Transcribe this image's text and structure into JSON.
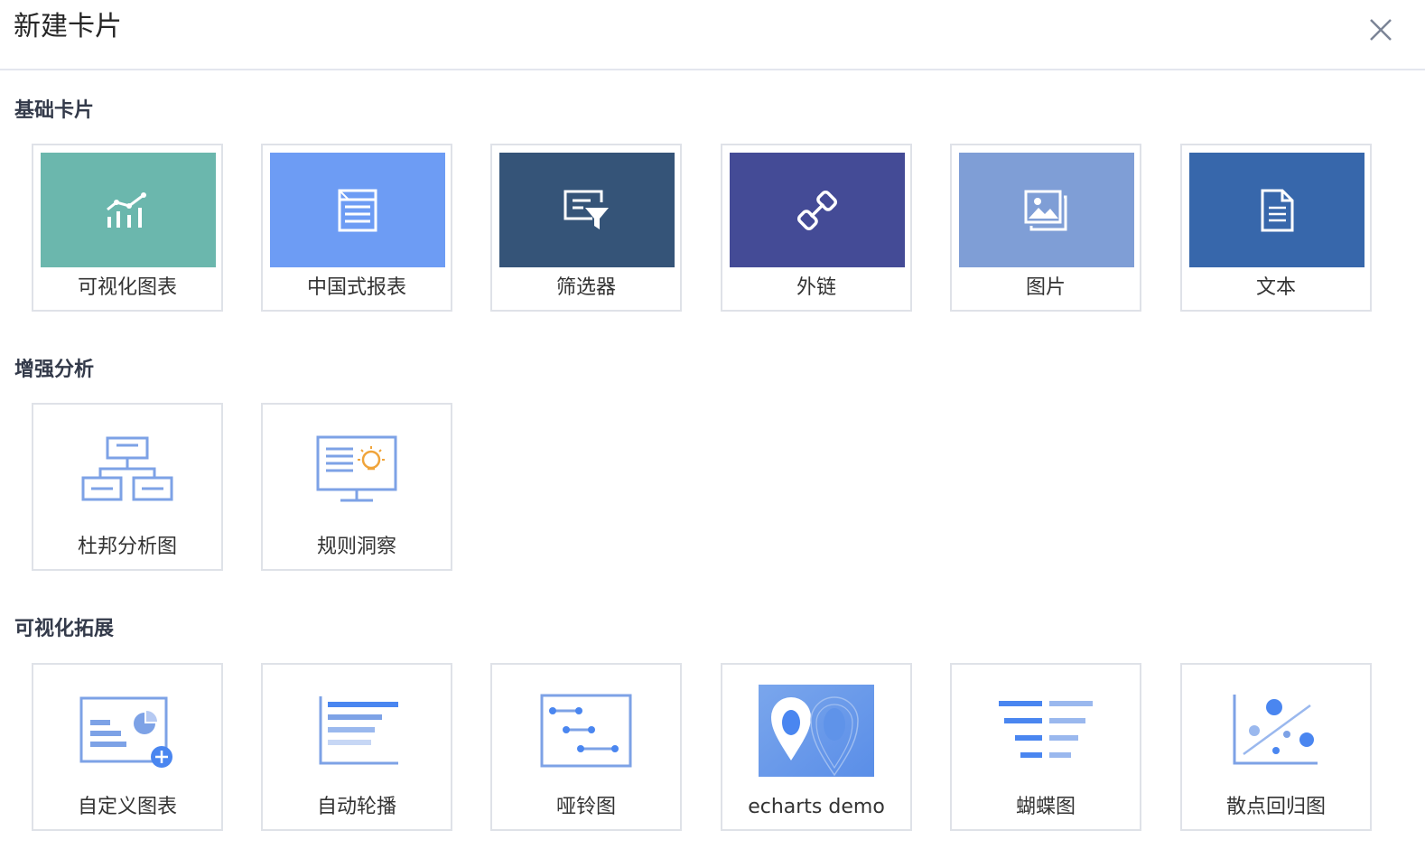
{
  "dialog": {
    "title": "新建卡片"
  },
  "sections": {
    "basic": {
      "title": "基础卡片",
      "cards": [
        {
          "label": "可视化图表",
          "color": "#6bb7ad",
          "icon": "bar-chart-icon"
        },
        {
          "label": "中国式报表",
          "color": "#6d9cf4",
          "icon": "table-report-icon"
        },
        {
          "label": "筛选器",
          "color": "#355478",
          "icon": "filter-icon"
        },
        {
          "label": "外链",
          "color": "#444b96",
          "icon": "link-icon"
        },
        {
          "label": "图片",
          "color": "#7f9ed6",
          "icon": "image-icon"
        },
        {
          "label": "文本",
          "color": "#3767ab",
          "icon": "document-icon"
        }
      ]
    },
    "enhanced": {
      "title": "增强分析",
      "cards": [
        {
          "label": "杜邦分析图",
          "icon": "org-tree-icon"
        },
        {
          "label": "规则洞察",
          "icon": "monitor-insight-icon"
        }
      ]
    },
    "extension": {
      "title": "可视化拓展",
      "cards": [
        {
          "label": "自定义图表",
          "icon": "custom-chart-icon"
        },
        {
          "label": "自动轮播",
          "icon": "carousel-bars-icon"
        },
        {
          "label": "哑铃图",
          "icon": "dumbbell-chart-icon"
        },
        {
          "label": "echarts demo",
          "icon": "map-pin-icon"
        },
        {
          "label": "蝴蝶图",
          "icon": "butterfly-chart-icon"
        },
        {
          "label": "散点回归图",
          "icon": "scatter-regression-icon"
        }
      ]
    }
  },
  "colors": {
    "accent": "#4a86f0",
    "icon_line": "#7da2e6"
  }
}
